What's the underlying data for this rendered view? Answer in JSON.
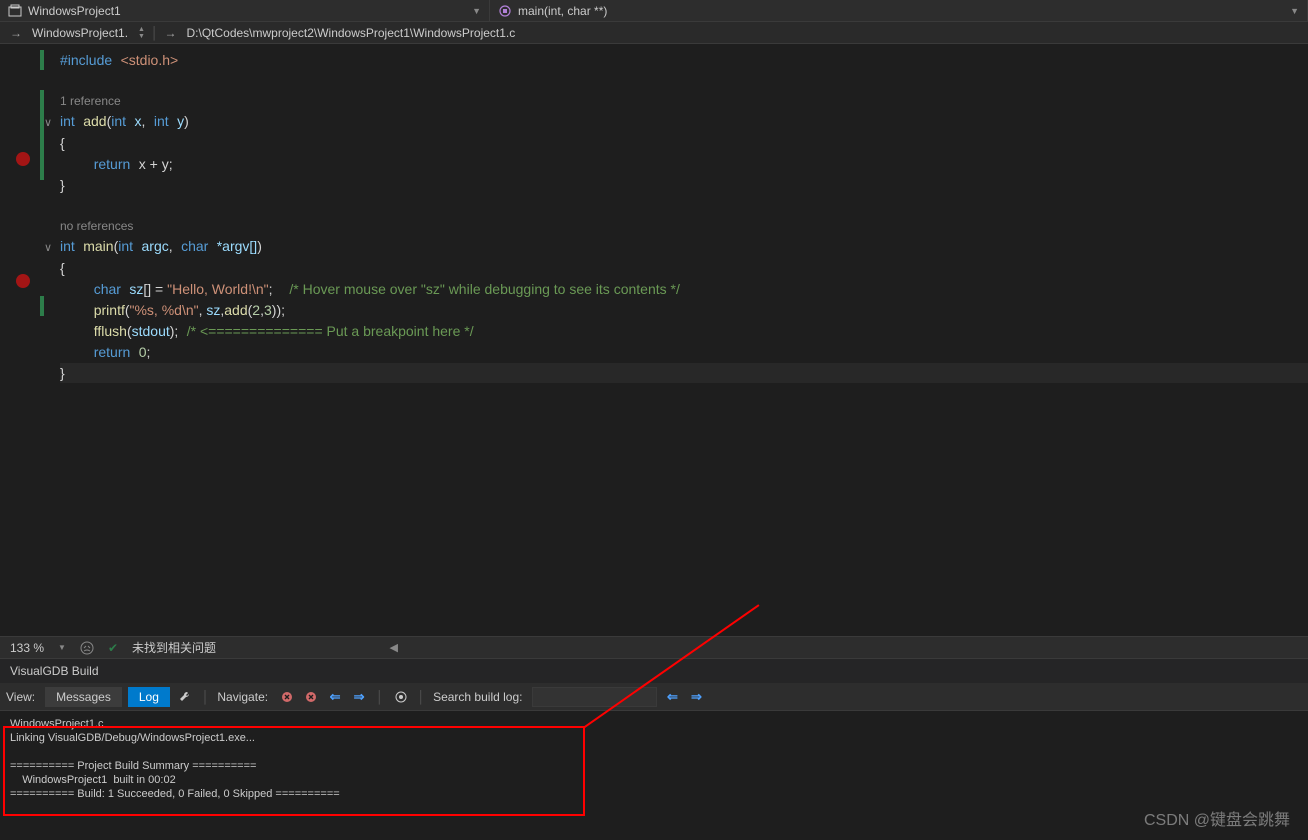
{
  "top": {
    "project_tab": "WindowsProject1",
    "function_tab": "main(int, char **)"
  },
  "nav": {
    "scope": "WindowsProject1.",
    "path": "D:\\QtCodes\\mwproject2\\WindowsProject1\\WindowsProject1.c"
  },
  "code": {
    "l1_include": "#include",
    "l1_header": "<stdio.h>",
    "l3_codelens": "1 reference",
    "l4_kw": "int",
    "l4_fn": "add",
    "l4_p1t": "int",
    "l4_p1n": "x",
    "l4_p2t": "int",
    "l4_p2n": "y",
    "l6_ret": "return",
    "l6_expr": "x + y;",
    "l9_codelens": "no references",
    "l10_kw": "int",
    "l10_fn": "main",
    "l10_p1t": "int",
    "l10_p1n": "argc",
    "l10_p2t": "char",
    "l10_p2n": "*argv[]",
    "l12_t": "char",
    "l12_v": "sz",
    "l12_str": "\"Hello, World!\\n\"",
    "l12_cmt": "/* Hover mouse over \"sz\" while debugging to see its contents */",
    "l13_fn": "printf",
    "l13_str": "\"%s, %d\\n\"",
    "l13_arg2": "sz",
    "l13_call": "add",
    "l13_n1": "2",
    "l13_n2": "3",
    "l14_fn": "fflush",
    "l14_arg": "stdout",
    "l14_cmt": "/* <============== Put a breakpoint here */",
    "l15_ret": "return",
    "l15_n": "0"
  },
  "status": {
    "zoom": "133 %",
    "issues": "未找到相关问题"
  },
  "panel": {
    "title": "VisualGDB Build",
    "view_label": "View:",
    "btn_messages": "Messages",
    "btn_log": "Log",
    "nav_label": "Navigate:",
    "search_label": "Search build log:",
    "search_value": ""
  },
  "log": {
    "l1": "WindowsProject1.c",
    "l2": "Linking VisualGDB/Debug/WindowsProject1.exe...",
    "l3": "========== Project Build Summary ==========",
    "l4": "    WindowsProject1  built in 00:02",
    "l5": "========== Build: 1 Succeeded, 0 Failed, 0 Skipped =========="
  },
  "watermark": "CSDN @键盘会跳舞"
}
